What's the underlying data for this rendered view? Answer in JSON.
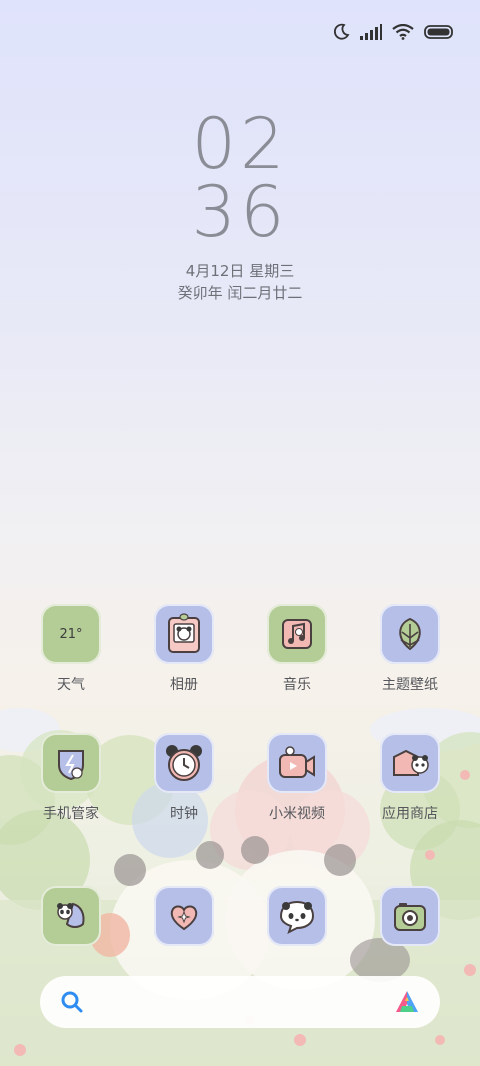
{
  "clock": {
    "hours": "02",
    "minutes": "36",
    "date": "4月12日 星期三",
    "lunar": "癸卯年 闰二月廿二"
  },
  "status_icons": [
    "moon-icon",
    "signal-icon",
    "wifi-icon",
    "battery-icon"
  ],
  "apps": [
    {
      "label": "天气",
      "icon": "weather-icon",
      "temp": "21°"
    },
    {
      "label": "相册",
      "icon": "gallery-icon"
    },
    {
      "label": "音乐",
      "icon": "music-icon"
    },
    {
      "label": "主题壁纸",
      "icon": "themes-icon"
    },
    {
      "label": "手机管家",
      "icon": "security-icon"
    },
    {
      "label": "时钟",
      "icon": "clock-icon"
    },
    {
      "label": "小米视频",
      "icon": "video-icon"
    },
    {
      "label": "应用商店",
      "icon": "app-store-icon"
    }
  ],
  "dock": [
    "phone-icon",
    "messages-icon",
    "chat-icon",
    "camera-icon"
  ],
  "search": {
    "icon": "search-icon",
    "assistant_icon": "ai-assistant-icon"
  },
  "colors": {
    "tile_green": "#b4cc95",
    "tile_blue": "#b6bfe8",
    "search_accent": "#2f8cf0"
  }
}
